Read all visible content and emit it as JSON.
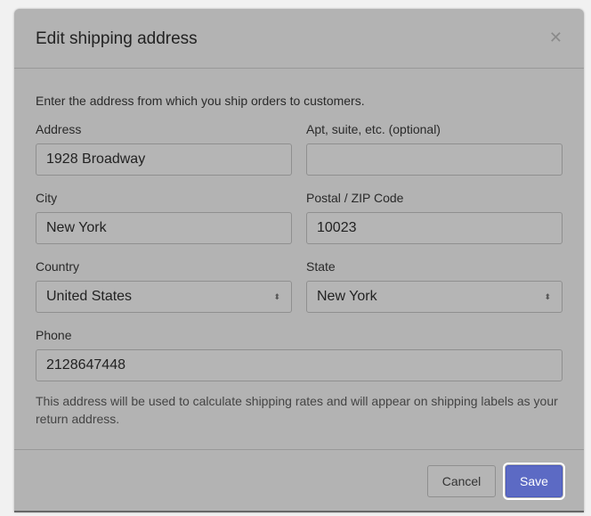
{
  "modal": {
    "title": "Edit shipping address",
    "close_icon": "close-icon",
    "intro": "Enter the address from which you ship orders to customers.",
    "fields": {
      "address": {
        "label": "Address",
        "value": "1928 Broadway"
      },
      "apt": {
        "label": "Apt, suite, etc. (optional)",
        "value": ""
      },
      "city": {
        "label": "City",
        "value": "New York"
      },
      "zip": {
        "label": "Postal / ZIP Code",
        "value": "10023"
      },
      "country": {
        "label": "Country",
        "value": "United States"
      },
      "state": {
        "label": "State",
        "value": "New York"
      },
      "phone": {
        "label": "Phone",
        "value": "2128647448"
      }
    },
    "note": "This address will be used to calculate shipping rates and will appear on shipping labels as your return address.",
    "cancel_label": "Cancel",
    "save_label": "Save"
  },
  "colors": {
    "primary": "#5c6ac4"
  }
}
